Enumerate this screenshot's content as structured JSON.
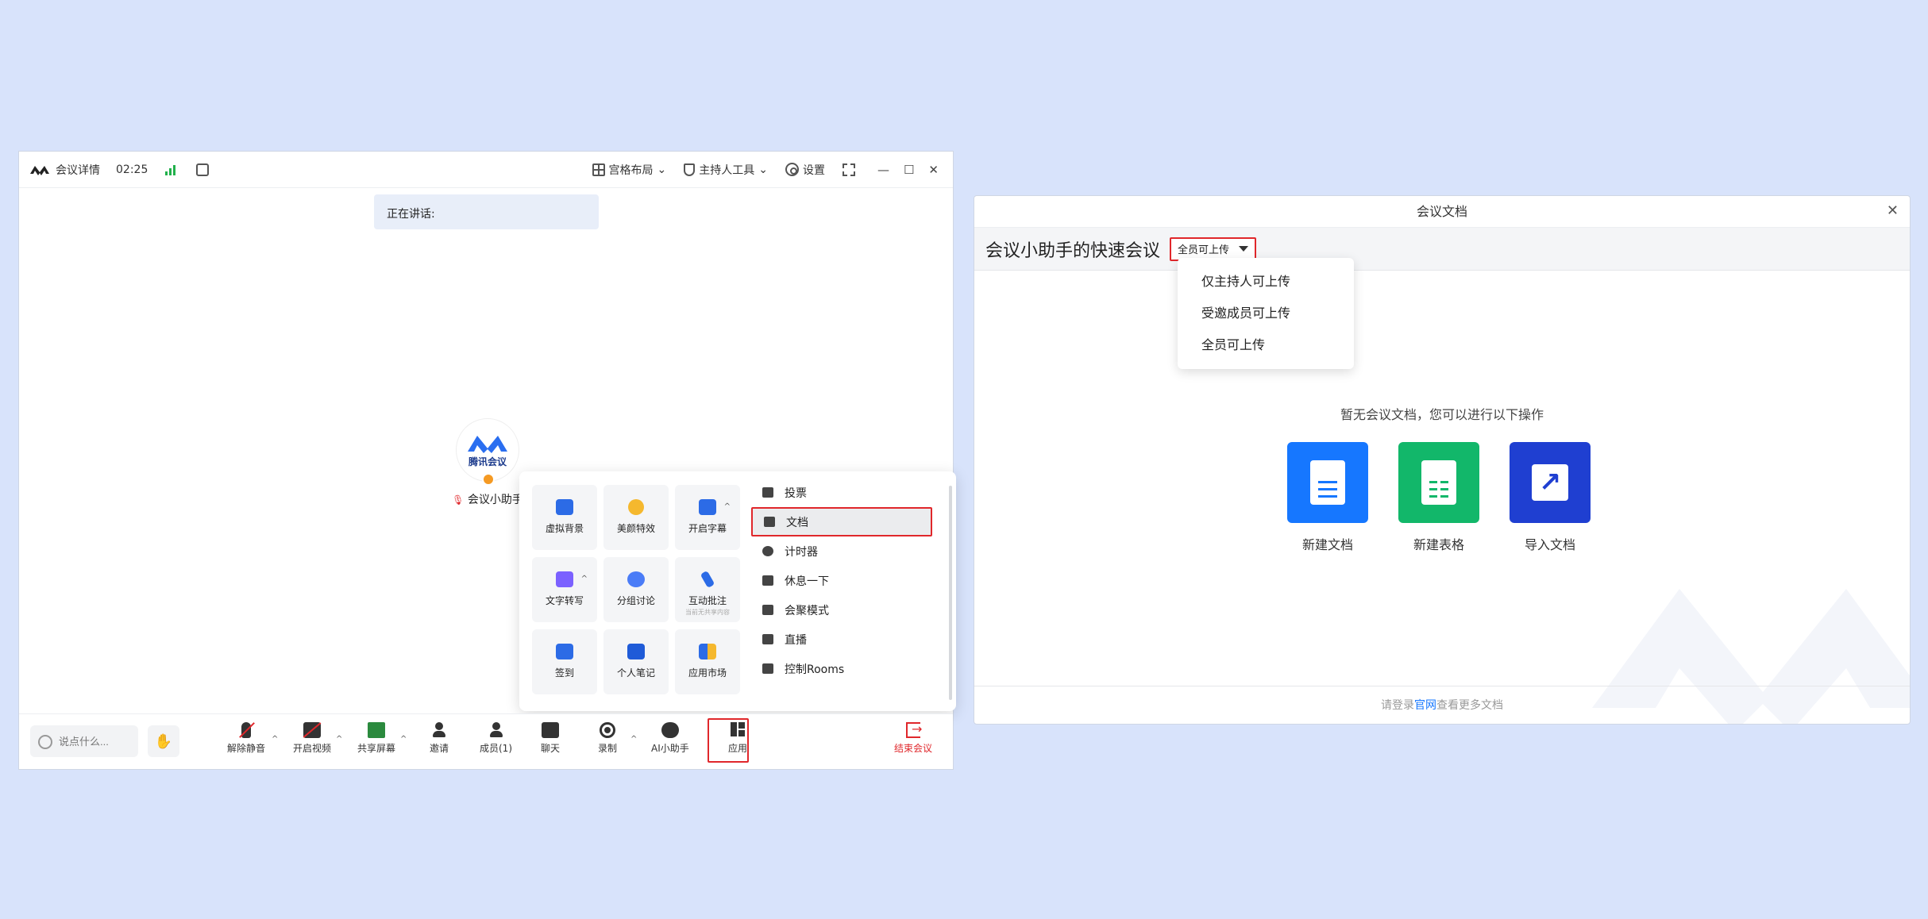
{
  "meeting_window": {
    "titlebar": {
      "details_label": "会议详情",
      "timer": "02:25",
      "layout_label": "宫格布局",
      "host_tools_label": "主持人工具",
      "settings_label": "设置",
      "minimize": "—",
      "maximize": "☐",
      "close": "✕"
    },
    "speaking_label": "正在讲话:",
    "participant": {
      "avatar_brand": "腾讯会议",
      "name": "会议小助手"
    },
    "toolbar": {
      "chat_placeholder": "说点什么...",
      "unmute": "解除静音",
      "start_video": "开启视频",
      "share_screen": "共享屏幕",
      "invite": "邀请",
      "members": "成员(1)",
      "chat": "聊天",
      "record": "录制",
      "ai_assistant": "AI小助手",
      "apps": "应用",
      "end_meeting": "结束会议"
    },
    "apps_popup": {
      "tiles": [
        {
          "label": "虚拟背景",
          "sub": ""
        },
        {
          "label": "美颜特效",
          "sub": ""
        },
        {
          "label": "开启字幕",
          "sub": ""
        },
        {
          "label": "文字转写",
          "sub": ""
        },
        {
          "label": "分组讨论",
          "sub": ""
        },
        {
          "label": "互动批注",
          "sub": "当前无共享内容"
        },
        {
          "label": "签到",
          "sub": ""
        },
        {
          "label": "个人笔记",
          "sub": ""
        },
        {
          "label": "应用市场",
          "sub": ""
        }
      ],
      "menu": [
        "投票",
        "文档",
        "计时器",
        "休息一下",
        "会聚模式",
        "直播",
        "控制Rooms"
      ]
    }
  },
  "doc_window": {
    "title": "会议文档",
    "close": "✕",
    "meeting_name": "会议小助手的快速会议",
    "permission_selected": "全员可上传",
    "permission_options": [
      "仅主持人可上传",
      "受邀成员可上传",
      "全员可上传"
    ],
    "empty_tip": "暂无会议文档，您可以进行以下操作",
    "actions": [
      "新建文档",
      "新建表格",
      "导入文档"
    ],
    "footer": {
      "before": "请登录",
      "link": "官网",
      "after": "查看更多文档"
    }
  },
  "colors": {
    "accent": "#1677ff",
    "danger": "#e0272b",
    "sheet_green": "#12b76a",
    "import_blue": "#1f3fd1"
  }
}
